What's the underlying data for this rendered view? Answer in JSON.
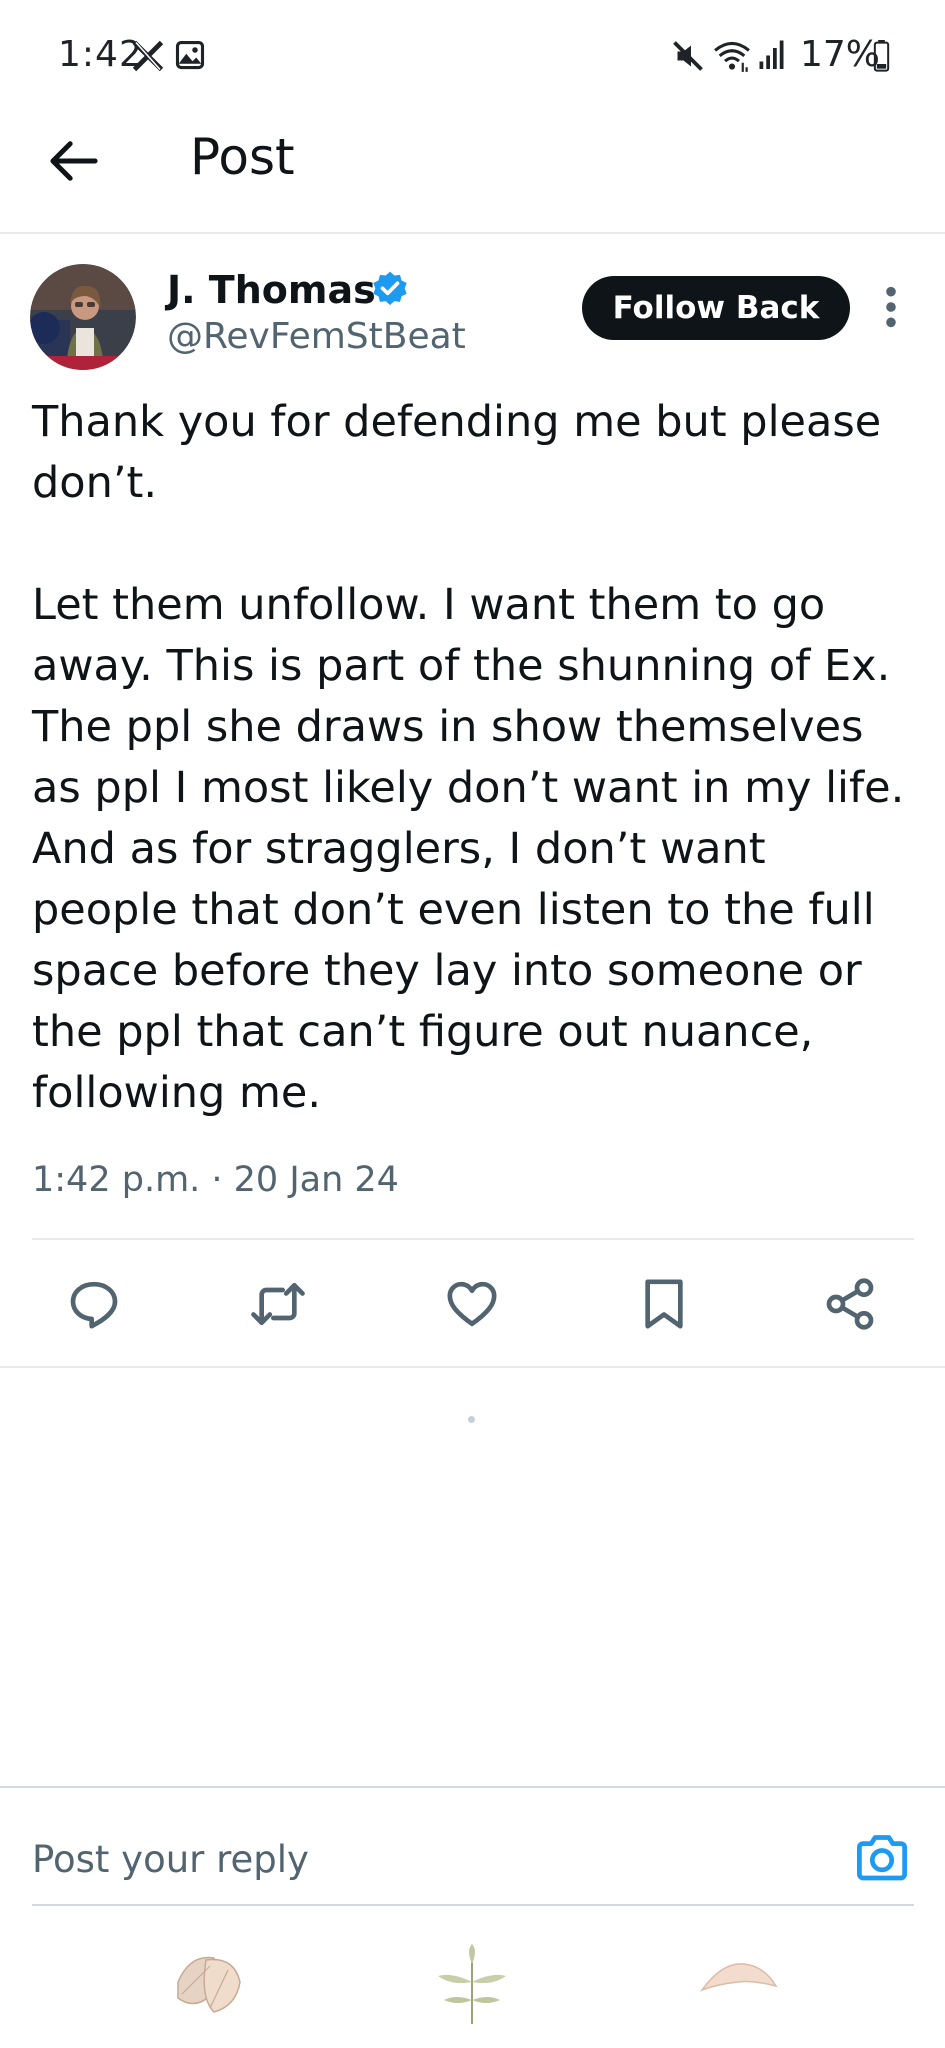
{
  "status_bar": {
    "time": "1:42",
    "battery_percent": "17%",
    "icons": [
      "x-app-icon",
      "gallery-icon",
      "mute-icon",
      "wifi-icon",
      "signal-icon",
      "battery-icon"
    ]
  },
  "header": {
    "title": "Post",
    "back_icon": "back-arrow-icon"
  },
  "post": {
    "author_name": "J. Thomas",
    "author_handle": "@RevFemStBeat",
    "verified": true,
    "follow_label": "Follow Back",
    "body": "Thank you for defending me but please don’t.\n\nLet them unfollow. I want them to go away. This is part of the shunning of Ex. The ppl she draws in show themselves as ppl I most likely don’t want in my life. And as for stragglers, I don’t want people that don’t even listen to the full space before they lay into someone or the ppl that can’t figure out nuance, following me.",
    "timestamp": "1:42 p.m. · 20 Jan 24",
    "actions": [
      "reply-icon",
      "repost-icon",
      "like-icon",
      "bookmark-icon",
      "share-icon"
    ]
  },
  "reply": {
    "placeholder": "Post your reply",
    "camera_icon": "camera-icon"
  },
  "colors": {
    "text": "#0f1419",
    "secondary": "#536471",
    "verified": "#1d9bf0",
    "divider": "#e7e9ea"
  }
}
